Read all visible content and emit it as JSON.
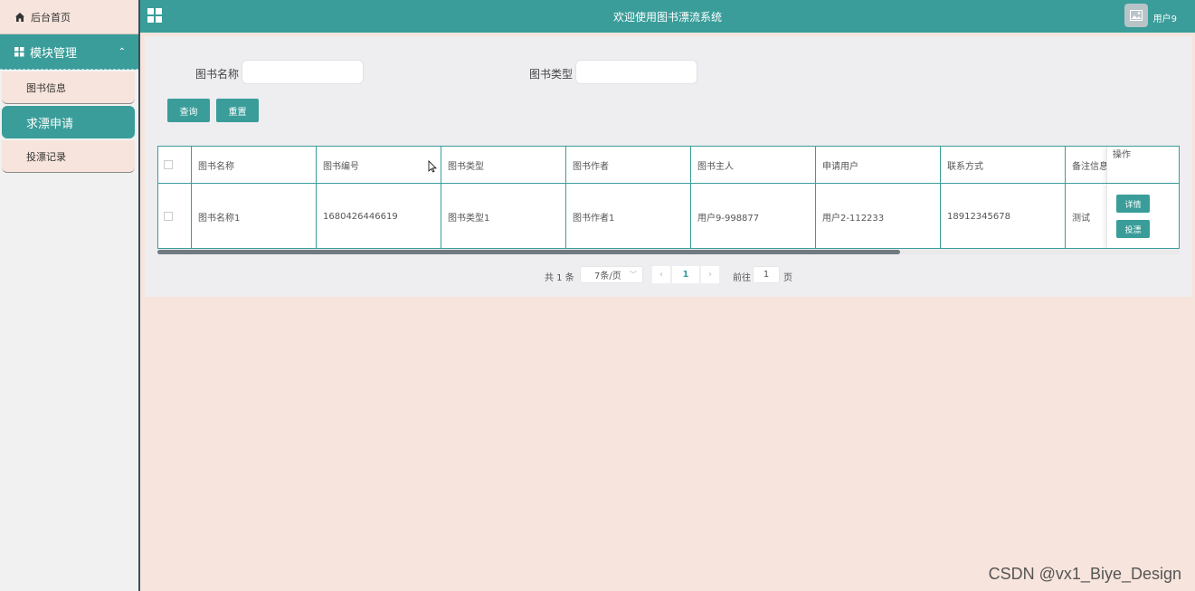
{
  "sidebar": {
    "home_label": "后台首页",
    "group_label": "模块管理",
    "items": [
      {
        "label": "图书信息",
        "active": false
      },
      {
        "label": "求漂申请",
        "active": true
      },
      {
        "label": "投漂记录",
        "active": false
      }
    ]
  },
  "header": {
    "title": "欢迎使用图书漂流系统",
    "user": "用户9"
  },
  "search": {
    "name_label": "图书名称",
    "name_value": "",
    "type_label": "图书类型",
    "type_value": "",
    "query_button": "查询",
    "reset_button": "重置"
  },
  "table": {
    "columns": [
      "图书名称",
      "图书编号",
      "图书类型",
      "图书作者",
      "图书主人",
      "申请用户",
      "联系方式",
      "备注信息",
      "操作"
    ],
    "rows": [
      {
        "cells": [
          "图书名称1",
          "1680426446619",
          "图书类型1",
          "图书作者1",
          "用户9-998877",
          "用户2-112233",
          "18912345678",
          "测试"
        ],
        "actions": [
          "详情",
          "投漂"
        ]
      }
    ]
  },
  "pagination": {
    "total": "共 1 条",
    "page_size": "7条/页",
    "current_page": "1",
    "goto_label": "前往",
    "goto_value": "1",
    "page_word": "页",
    "prev_icon": "chevron-left-icon",
    "next_icon": "chevron-right-icon"
  },
  "watermark": "CSDN @vx1_Biye_Design",
  "colors": {
    "accent": "#3a9d9a",
    "background": "#f7e4dc",
    "panel": "#eeedf0"
  }
}
